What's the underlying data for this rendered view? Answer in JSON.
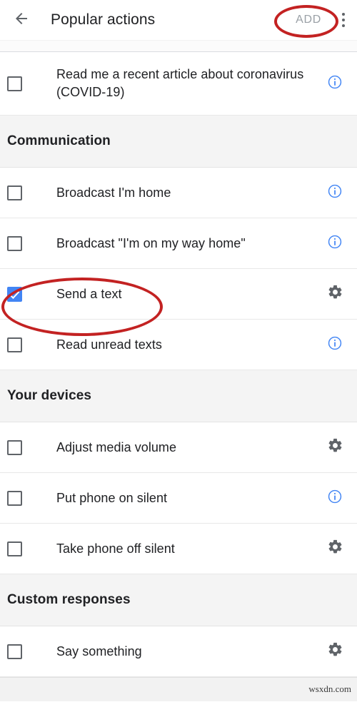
{
  "appbar": {
    "back_icon": "arrow-left-icon",
    "title": "Popular actions",
    "add_label": "ADD",
    "overflow_icon": "more-vertical-icon"
  },
  "list": [
    {
      "kind": "item",
      "label": "Read me a recent article about coronavirus (COVID-19)",
      "checked": false,
      "trailing_icon": "info-icon",
      "tall": true
    },
    {
      "kind": "section",
      "label": "Communication"
    },
    {
      "kind": "item",
      "label": "Broadcast I'm home",
      "checked": false,
      "trailing_icon": "info-icon",
      "tall": false
    },
    {
      "kind": "item",
      "label": "Broadcast \"I'm on my way home\"",
      "checked": false,
      "trailing_icon": "info-icon",
      "tall": false
    },
    {
      "kind": "item",
      "label": "Send a text",
      "checked": true,
      "trailing_icon": "gear-icon",
      "tall": false
    },
    {
      "kind": "item",
      "label": "Read unread texts",
      "checked": false,
      "trailing_icon": "info-icon",
      "tall": false
    },
    {
      "kind": "section",
      "label": "Your devices"
    },
    {
      "kind": "item",
      "label": "Adjust media volume",
      "checked": false,
      "trailing_icon": "gear-icon",
      "tall": false
    },
    {
      "kind": "item",
      "label": "Put phone on silent",
      "checked": false,
      "trailing_icon": "info-icon",
      "tall": false
    },
    {
      "kind": "item",
      "label": "Take phone off silent",
      "checked": false,
      "trailing_icon": "gear-icon",
      "tall": false
    },
    {
      "kind": "section",
      "label": "Custom responses"
    },
    {
      "kind": "item",
      "label": "Say something",
      "checked": false,
      "trailing_icon": "gear-icon",
      "tall": false
    }
  ],
  "footer": {
    "watermark": "wsxdn.com"
  },
  "annotations": {
    "color": "#c32222",
    "shapes": [
      {
        "name": "annotation-ellipse-add",
        "target": "ADD"
      },
      {
        "name": "annotation-ellipse-send-a-text",
        "target": "Send a text"
      }
    ]
  },
  "colors": {
    "accent_checkbox": "#4285f4",
    "info_icon": "#4285f4",
    "gear_icon": "#5f6368",
    "section_background": "#f4f4f4",
    "annotation": "#c32222"
  }
}
